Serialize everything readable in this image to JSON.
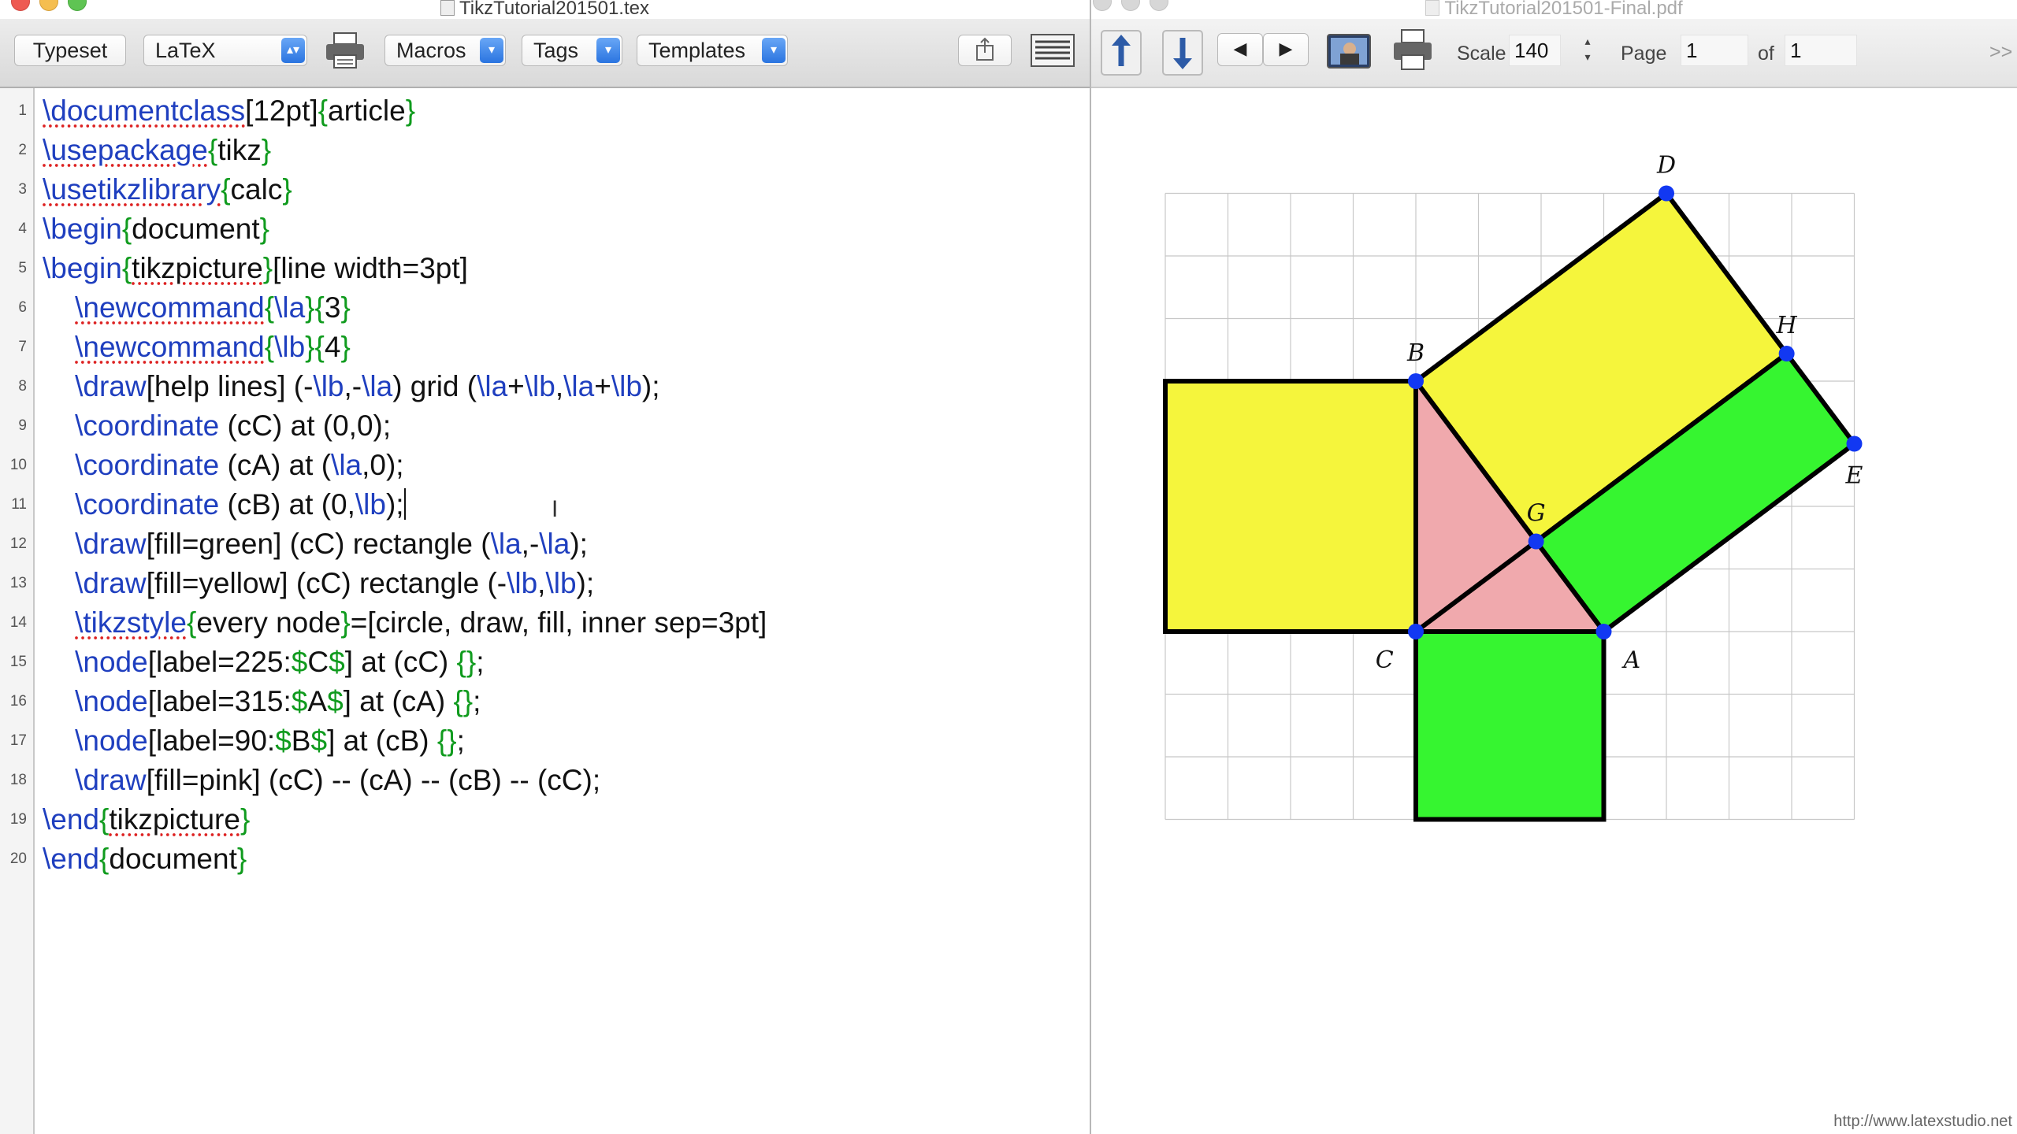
{
  "editor": {
    "title": "TikzTutorial201501.tex",
    "toolbar": {
      "typeset": "Typeset",
      "format": "LaTeX",
      "macros": "Macros",
      "tags": "Tags",
      "templates": "Templates"
    },
    "line_numbers": [
      "1",
      "2",
      "3",
      "4",
      "5",
      "6",
      "7",
      "8",
      "9",
      "10",
      "11",
      "12",
      "13",
      "14",
      "15",
      "16",
      "17",
      "18",
      "19",
      "20"
    ],
    "code_lines": [
      [
        [
          "kw spell",
          "\\documentclass"
        ],
        [
          "tx",
          "[12pt]"
        ],
        [
          "br",
          "{"
        ],
        [
          "tx",
          "article"
        ],
        [
          "br",
          "}"
        ]
      ],
      [
        [
          "kw spell",
          "\\usepackage"
        ],
        [
          "br",
          "{"
        ],
        [
          "tx",
          "tikz"
        ],
        [
          "br",
          "}"
        ]
      ],
      [
        [
          "kw spell",
          "\\usetikzlibrary"
        ],
        [
          "br",
          "{"
        ],
        [
          "tx",
          "calc"
        ],
        [
          "br",
          "}"
        ]
      ],
      [
        [
          "kw",
          "\\begin"
        ],
        [
          "br",
          "{"
        ],
        [
          "tx",
          "document"
        ],
        [
          "br",
          "}"
        ]
      ],
      [
        [
          "kw",
          "\\begin"
        ],
        [
          "br",
          "{"
        ],
        [
          "tx spell",
          "tikzpicture"
        ],
        [
          "br",
          "}"
        ],
        [
          "tx",
          "[line width=3pt]"
        ]
      ],
      [
        [
          "tx",
          "    "
        ],
        [
          "kw spell",
          "\\newcommand"
        ],
        [
          "br",
          "{"
        ],
        [
          "kw",
          "\\la"
        ],
        [
          "br",
          "}{"
        ],
        [
          "tx",
          "3"
        ],
        [
          "br",
          "}"
        ]
      ],
      [
        [
          "tx",
          "    "
        ],
        [
          "kw spell",
          "\\newcommand"
        ],
        [
          "br",
          "{"
        ],
        [
          "kw",
          "\\lb"
        ],
        [
          "br",
          "}{"
        ],
        [
          "tx",
          "4"
        ],
        [
          "br",
          "}"
        ]
      ],
      [
        [
          "tx",
          "    "
        ],
        [
          "kw",
          "\\draw"
        ],
        [
          "tx",
          "[help lines] (-"
        ],
        [
          "kw",
          "\\lb"
        ],
        [
          "tx",
          ",-"
        ],
        [
          "kw",
          "\\la"
        ],
        [
          "tx",
          ") grid ("
        ],
        [
          "kw",
          "\\la"
        ],
        [
          "tx",
          "+"
        ],
        [
          "kw",
          "\\lb"
        ],
        [
          "tx",
          ","
        ],
        [
          "kw",
          "\\la"
        ],
        [
          "tx",
          "+"
        ],
        [
          "kw",
          "\\lb"
        ],
        [
          "tx",
          ");"
        ]
      ],
      [
        [
          "tx",
          "    "
        ],
        [
          "kw",
          "\\coordinate"
        ],
        [
          "tx",
          " (cC) at (0,0);"
        ]
      ],
      [
        [
          "tx",
          "    "
        ],
        [
          "kw",
          "\\coordinate"
        ],
        [
          "tx",
          " (cA) at ("
        ],
        [
          "kw",
          "\\la"
        ],
        [
          "tx",
          ",0);"
        ]
      ],
      [
        [
          "tx",
          "    "
        ],
        [
          "kw",
          "\\coordinate"
        ],
        [
          "tx",
          " (cB) at (0,"
        ],
        [
          "kw",
          "\\lb"
        ],
        [
          "tx",
          ");"
        ],
        [
          "caret",
          ""
        ]
      ],
      [
        [
          "tx",
          "    "
        ],
        [
          "kw",
          "\\draw"
        ],
        [
          "tx",
          "[fill=green] (cC) rectangle ("
        ],
        [
          "kw",
          "\\la"
        ],
        [
          "tx",
          ",-"
        ],
        [
          "kw",
          "\\la"
        ],
        [
          "tx",
          ");"
        ]
      ],
      [
        [
          "tx",
          "    "
        ],
        [
          "kw",
          "\\draw"
        ],
        [
          "tx",
          "[fill=yellow] (cC) rectangle (-"
        ],
        [
          "kw",
          "\\lb"
        ],
        [
          "tx",
          ","
        ],
        [
          "kw",
          "\\lb"
        ],
        [
          "tx",
          ");"
        ]
      ],
      [
        [
          "tx",
          "    "
        ],
        [
          "kw spell",
          "\\tikzstyle"
        ],
        [
          "br",
          "{"
        ],
        [
          "tx",
          "every node"
        ],
        [
          "br",
          "}"
        ],
        [
          "tx",
          "=[circle, draw, fill, inner sep=3pt]"
        ]
      ],
      [
        [
          "tx",
          "    "
        ],
        [
          "kw",
          "\\node"
        ],
        [
          "tx",
          "[label=225:"
        ],
        [
          "ds",
          "$"
        ],
        [
          "tx",
          "C"
        ],
        [
          "ds",
          "$"
        ],
        [
          "tx",
          "] at (cC) "
        ],
        [
          "br",
          "{}"
        ],
        [
          "tx",
          ";"
        ]
      ],
      [
        [
          "tx",
          "    "
        ],
        [
          "kw",
          "\\node"
        ],
        [
          "tx",
          "[label=315:"
        ],
        [
          "ds",
          "$"
        ],
        [
          "tx",
          "A"
        ],
        [
          "ds",
          "$"
        ],
        [
          "tx",
          "] at (cA) "
        ],
        [
          "br",
          "{}"
        ],
        [
          "tx",
          ";"
        ]
      ],
      [
        [
          "tx",
          "    "
        ],
        [
          "kw",
          "\\node"
        ],
        [
          "tx",
          "[label=90:"
        ],
        [
          "ds",
          "$"
        ],
        [
          "tx",
          "B"
        ],
        [
          "ds",
          "$"
        ],
        [
          "tx",
          "] at (cB) "
        ],
        [
          "br",
          "{}"
        ],
        [
          "tx",
          ";"
        ]
      ],
      [
        [
          "tx",
          "    "
        ],
        [
          "kw",
          "\\draw"
        ],
        [
          "tx",
          "[fill=pink] (cC) -- (cA) -- (cB) -- (cC);"
        ]
      ],
      [
        [
          "kw",
          "\\end"
        ],
        [
          "br",
          "{"
        ],
        [
          "tx spell",
          "tikzpicture"
        ],
        [
          "br",
          "}"
        ]
      ],
      [
        [
          "kw",
          "\\end"
        ],
        [
          "br",
          "{"
        ],
        [
          "tx",
          "document"
        ],
        [
          "br",
          "}"
        ]
      ]
    ]
  },
  "preview": {
    "title": "TikzTutorial201501-Final.pdf",
    "scale_label": "Scale",
    "scale_value": "140",
    "page_label": "Page",
    "page_value": "1",
    "of_label": "of",
    "of_value": "1",
    "more": ">>",
    "watermark": "http://www.latexstudio.net"
  },
  "figure": {
    "grid": {
      "xmin": -4,
      "xmax": 7,
      "ymin": -3,
      "ymax": 7
    },
    "shapes": [
      {
        "name": "yellow-square-left",
        "fill": "#f5f53c",
        "points": [
          [
            0,
            0
          ],
          [
            -4,
            0
          ],
          [
            -4,
            4
          ],
          [
            0,
            4
          ]
        ]
      },
      {
        "name": "green-square-bottom",
        "fill": "#36f530",
        "points": [
          [
            0,
            0
          ],
          [
            3,
            0
          ],
          [
            3,
            -3
          ],
          [
            0,
            -3
          ]
        ]
      },
      {
        "name": "yellow-rect-top",
        "fill": "#f5f53c",
        "points": [
          [
            0,
            4
          ],
          [
            4,
            7
          ],
          [
            5.92,
            4.44
          ],
          [
            1.92,
            1.44
          ]
        ]
      },
      {
        "name": "green-rect-right",
        "fill": "#36f530",
        "points": [
          [
            1.92,
            1.44
          ],
          [
            5.92,
            4.44
          ],
          [
            7,
            3
          ],
          [
            3,
            0
          ]
        ]
      },
      {
        "name": "pink-triangle",
        "fill": "#f0a9ad",
        "points": [
          [
            0,
            0
          ],
          [
            3,
            0
          ],
          [
            0,
            4
          ]
        ]
      }
    ],
    "lines": [
      {
        "name": "altitude-line",
        "from": [
          0,
          0
        ],
        "to": [
          1.92,
          1.44
        ]
      }
    ],
    "points": [
      {
        "label": "A",
        "x": 3,
        "y": 0,
        "label_dx": 0.45,
        "label_dy": -0.45
      },
      {
        "label": "B",
        "x": 0,
        "y": 4,
        "label_dx": 0,
        "label_dy": 0.45
      },
      {
        "label": "C",
        "x": 0,
        "y": 0,
        "label_dx": -0.5,
        "label_dy": -0.45
      },
      {
        "label": "D",
        "x": 4,
        "y": 7,
        "label_dx": 0,
        "label_dy": 0.45
      },
      {
        "label": "E",
        "x": 7,
        "y": 3,
        "label_dx": 0,
        "label_dy": -0.5
      },
      {
        "label": "G",
        "x": 1.92,
        "y": 1.44,
        "label_dx": 0,
        "label_dy": 0.45
      },
      {
        "label": "H",
        "x": 5.92,
        "y": 4.44,
        "label_dx": 0,
        "label_dy": 0.45
      }
    ],
    "point_color": "#1238f2"
  }
}
